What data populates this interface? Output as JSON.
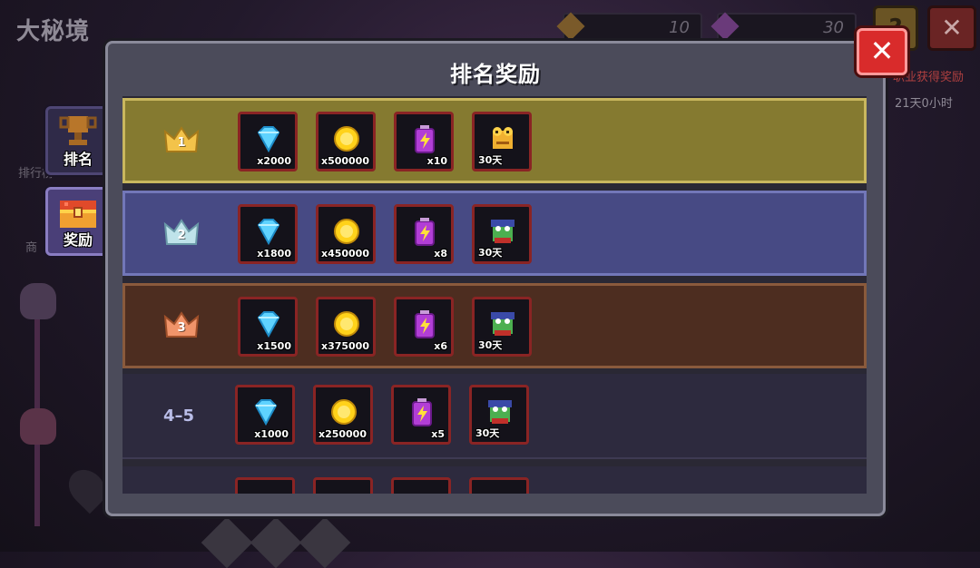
{
  "background": {
    "title": "大秘境",
    "resource_a_value": "10",
    "resource_b_value": "30",
    "help_label": "?",
    "close_label": "✕",
    "side_text_1": "职业获得奖励",
    "side_text_2": "21天0小时",
    "left_label_1": "排行榜",
    "left_label_2": "商"
  },
  "tabs": [
    {
      "label": "排名",
      "icon": "trophy-icon"
    },
    {
      "label": "奖励",
      "icon": "chest-icon"
    }
  ],
  "modal": {
    "title": "排名奖励",
    "close_label": "✕"
  },
  "rows": [
    {
      "rank": "1",
      "rank_style": "gold-crown",
      "items": [
        {
          "icon": "diamond-icon",
          "qty": "x2000"
        },
        {
          "icon": "coin-icon",
          "qty": "x500000"
        },
        {
          "icon": "energy-battery-icon",
          "qty": "x10"
        },
        {
          "icon": "golden-frog-skin-icon",
          "days": "30天"
        }
      ]
    },
    {
      "rank": "2",
      "rank_style": "silver-crown",
      "items": [
        {
          "icon": "diamond-icon",
          "qty": "x1800"
        },
        {
          "icon": "coin-icon",
          "qty": "x450000"
        },
        {
          "icon": "energy-battery-icon",
          "qty": "x8"
        },
        {
          "icon": "frog-skin-icon",
          "days": "30天"
        }
      ]
    },
    {
      "rank": "3",
      "rank_style": "bronze-crown",
      "items": [
        {
          "icon": "diamond-icon",
          "qty": "x1500"
        },
        {
          "icon": "coin-icon",
          "qty": "x375000"
        },
        {
          "icon": "energy-battery-icon",
          "qty": "x6"
        },
        {
          "icon": "frog-skin-icon",
          "days": "30天"
        }
      ]
    },
    {
      "rank": "4–5",
      "rank_style": "text",
      "items": [
        {
          "icon": "diamond-icon",
          "qty": "x1000"
        },
        {
          "icon": "coin-icon",
          "qty": "x250000"
        },
        {
          "icon": "energy-battery-icon",
          "qty": "x5"
        },
        {
          "icon": "frog-skin-icon",
          "days": "30天"
        }
      ]
    }
  ],
  "colors": {
    "gold_row": "#857a30",
    "silver_row": "#474a84",
    "bronze_row": "#4d2d20",
    "close_red": "#d92b2b",
    "item_border": "#8a2424"
  }
}
